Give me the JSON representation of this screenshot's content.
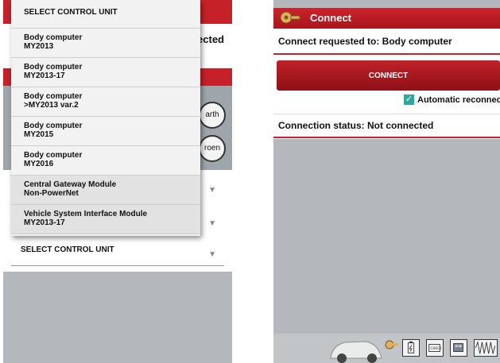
{
  "left_screen": {
    "connected_fragment": "ected",
    "round_buttons": [
      "arth",
      "roen"
    ],
    "menu": {
      "header": "SELECT CONTROL UNIT",
      "items": [
        {
          "line1": "Body computer",
          "line2": "MY2013"
        },
        {
          "line1": "Body computer",
          "line2": "MY2013-17"
        },
        {
          "line1": "Body computer",
          "line2": ">MY2013 var.2"
        },
        {
          "line1": "Body computer",
          "line2": "MY2015"
        },
        {
          "line1": "Body computer",
          "line2": "MY2016"
        },
        {
          "line1": "Central Gateway Module",
          "line2": "Non-PowerNet"
        },
        {
          "line1": "Vehicle System Interface Module",
          "line2": "MY2013-17"
        }
      ]
    },
    "bottom_dropdown_label": "SELECT CONTROL UNIT"
  },
  "right_screen": {
    "title": "Connect",
    "connect_requested": "Connect requested to: Body computer",
    "connect_button": "CONNECT",
    "auto_reconnect": {
      "label": "Automatic reconnect",
      "checked": true
    },
    "connection_status": "Connection status: Not connected",
    "toolbar_icons": [
      "car-icon",
      "key-icon",
      "battery-icon",
      "check-engine-icon",
      "engine-icon",
      "waveform-icon"
    ]
  },
  "colors": {
    "accent_red": "#c62128",
    "checkbox_teal": "#2fa79a",
    "background_gray": "#b4b7bb"
  }
}
